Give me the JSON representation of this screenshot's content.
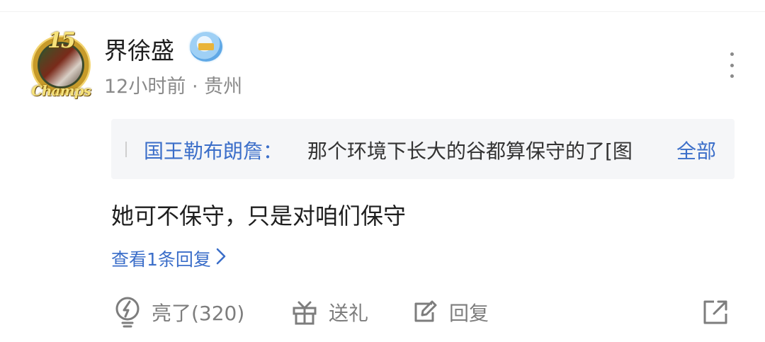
{
  "avatar": {
    "level": "15",
    "tag": "Champs"
  },
  "user": {
    "name": "界徐盛",
    "badge_icon": "player-badge-icon"
  },
  "meta": {
    "time": "12小时前",
    "separator": " · ",
    "location": "贵州"
  },
  "quote": {
    "author": "国王勒布朗詹：",
    "text": "那个环境下长大的谷都算保守的了[图",
    "expand": "全部"
  },
  "content": "她可不保守，只是对咱们保守",
  "replies": {
    "label": "查看1条回复",
    "chevron": "›"
  },
  "actions": {
    "like": {
      "label": "亮了(320)",
      "icon": "lightning-bulb-icon"
    },
    "gift": {
      "label": "送礼",
      "icon": "gift-icon"
    },
    "reply": {
      "label": "回复",
      "icon": "edit-comment-icon"
    },
    "share": {
      "icon": "share-external-icon"
    }
  },
  "colors": {
    "link": "#3b6ec9",
    "muted": "#8a8a8a",
    "quote_bg": "#f5f6f8"
  }
}
